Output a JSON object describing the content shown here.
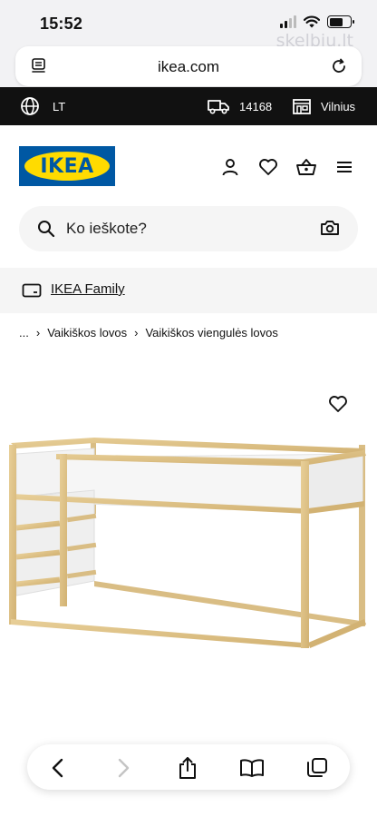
{
  "status_bar": {
    "time": "15:52"
  },
  "watermark": "skelbiu.lt",
  "browser": {
    "url": "ikea.com"
  },
  "top_strip": {
    "language": "LT",
    "postcode": "14168",
    "store": "Vilnius"
  },
  "logo": {
    "text": "IKEA"
  },
  "search": {
    "placeholder": "Ko ieškote?"
  },
  "family": {
    "label": "IKEA Family"
  },
  "breadcrumb": {
    "ellipsis": "...",
    "items": [
      "Vaikiškos lovos",
      "Vaikiškos viengulės lovos"
    ]
  },
  "colors": {
    "ikea_blue": "#0058a3",
    "ikea_yellow": "#ffdb00",
    "strip": "#111111"
  },
  "icons": [
    "reader-icon",
    "reload-icon",
    "globe-icon",
    "truck-icon",
    "store-icon",
    "profile-icon",
    "heart-icon",
    "basket-icon",
    "menu-icon",
    "search-icon",
    "camera-icon",
    "card-icon",
    "back-icon",
    "forward-icon",
    "share-icon",
    "bookmarks-icon",
    "tabs-icon"
  ]
}
